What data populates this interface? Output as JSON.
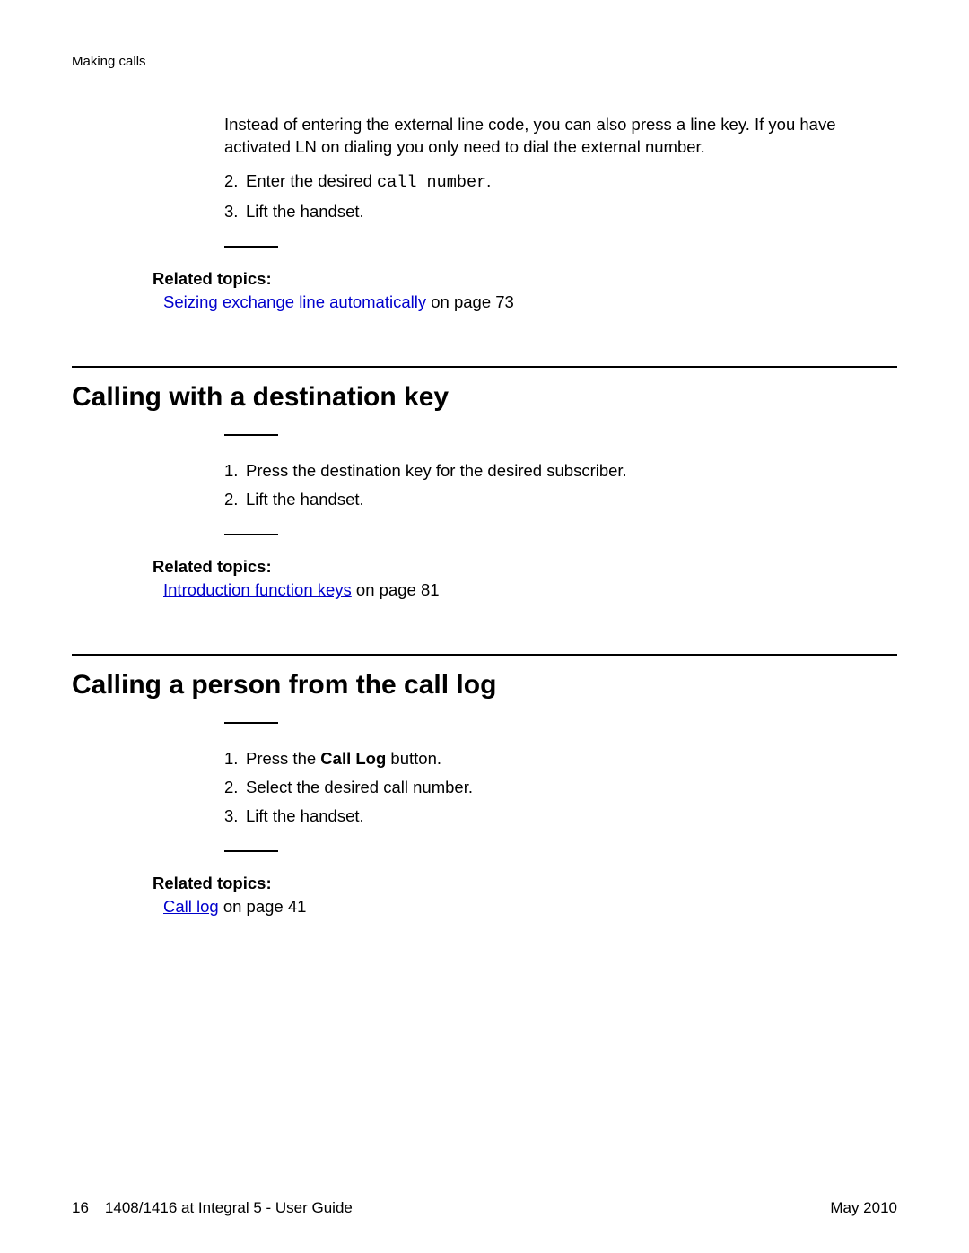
{
  "header": {
    "running_title": "Making calls"
  },
  "intro_paragraph": "Instead of entering the external line code, you can also press a line key. If you have activated LN on dialing you only need to dial the external number.",
  "section0": {
    "steps": [
      {
        "num": "2.",
        "prefix": "Enter the desired ",
        "mono": "call number",
        "suffix": "."
      },
      {
        "num": "3.",
        "text": "Lift the handset."
      }
    ],
    "related_heading": "Related topics:",
    "related": {
      "link": "Seizing exchange line automatically",
      "suffix": " on page 73"
    }
  },
  "section1": {
    "heading": "Calling with a destination key",
    "steps": [
      {
        "num": "1.",
        "text": "Press the destination key for the desired subscriber."
      },
      {
        "num": "2.",
        "text": "Lift the handset."
      }
    ],
    "related_heading": "Related topics:",
    "related": {
      "link": "Introduction function keys",
      "suffix": " on page 81"
    }
  },
  "section2": {
    "heading": "Calling a person from the call log",
    "steps": [
      {
        "num": "1.",
        "prefix": "Press the ",
        "bold": "Call Log",
        "suffix": " button."
      },
      {
        "num": "2.",
        "text": "Select the desired call number."
      },
      {
        "num": "3.",
        "text": "Lift the handset."
      }
    ],
    "related_heading": "Related topics:",
    "related": {
      "link": "Call log",
      "suffix": " on page 41"
    }
  },
  "footer": {
    "page_number": "16",
    "doc_title": "1408/1416 at Integral 5 - User Guide",
    "date": "May 2010"
  }
}
